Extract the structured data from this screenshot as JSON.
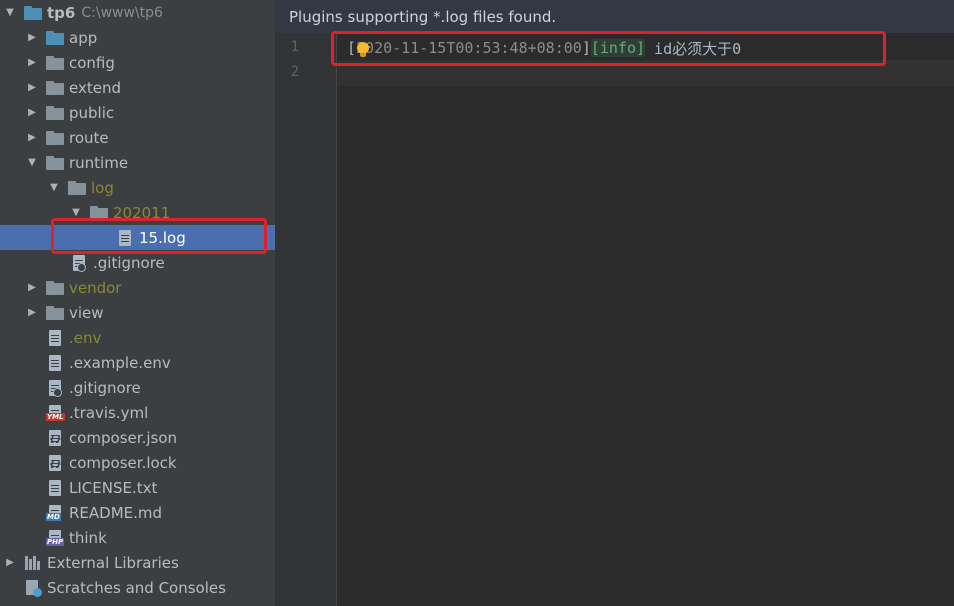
{
  "project": {
    "name": "tp6",
    "path": "C:\\www\\tp6"
  },
  "tree": {
    "app": "app",
    "config": "config",
    "extend": "extend",
    "public": "public",
    "route": "route",
    "runtime": "runtime",
    "log": "log",
    "month": "202011",
    "logfile": "15.log",
    "gitignore_runtime": ".gitignore",
    "vendor": "vendor",
    "view": "view",
    "env": ".env",
    "example_env": ".example.env",
    "gitignore": ".gitignore",
    "travis": ".travis.yml",
    "composer_json": "composer.json",
    "composer_lock": "composer.lock",
    "license": "LICENSE.txt",
    "readme": "README.md",
    "think": "think",
    "external_libraries": "External Libraries",
    "scratches": "Scratches and Consoles"
  },
  "editor": {
    "banner": "Plugins supporting *.log files found.",
    "lines": [
      "1",
      "2"
    ],
    "log_open": "[",
    "timestamp": "2020-11-15T00:53:48+08:00",
    "log_close": "]",
    "level": "[info]",
    "message": " id必须大于0"
  }
}
